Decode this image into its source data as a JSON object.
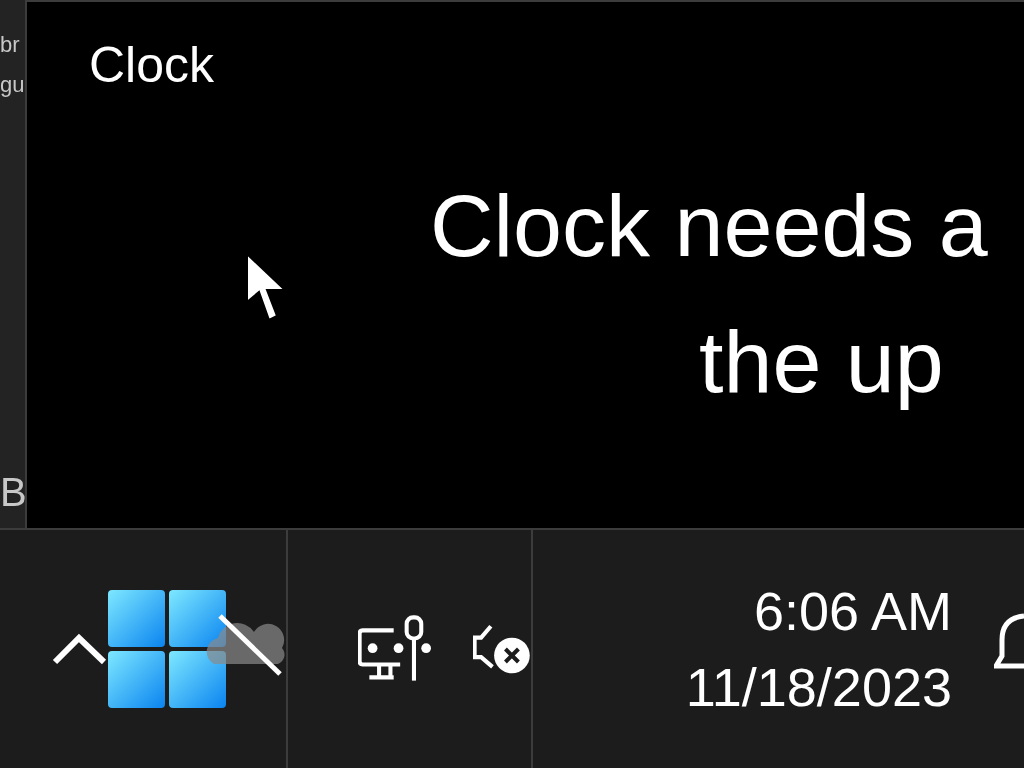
{
  "background_window": {
    "texts": [
      "br",
      "gu",
      "B"
    ]
  },
  "app_window": {
    "title": "Clock",
    "message_lines": [
      "Clock needs a",
      "the up"
    ]
  },
  "taskbar": {
    "time": "6:06 AM",
    "date": "11/18/2023"
  }
}
